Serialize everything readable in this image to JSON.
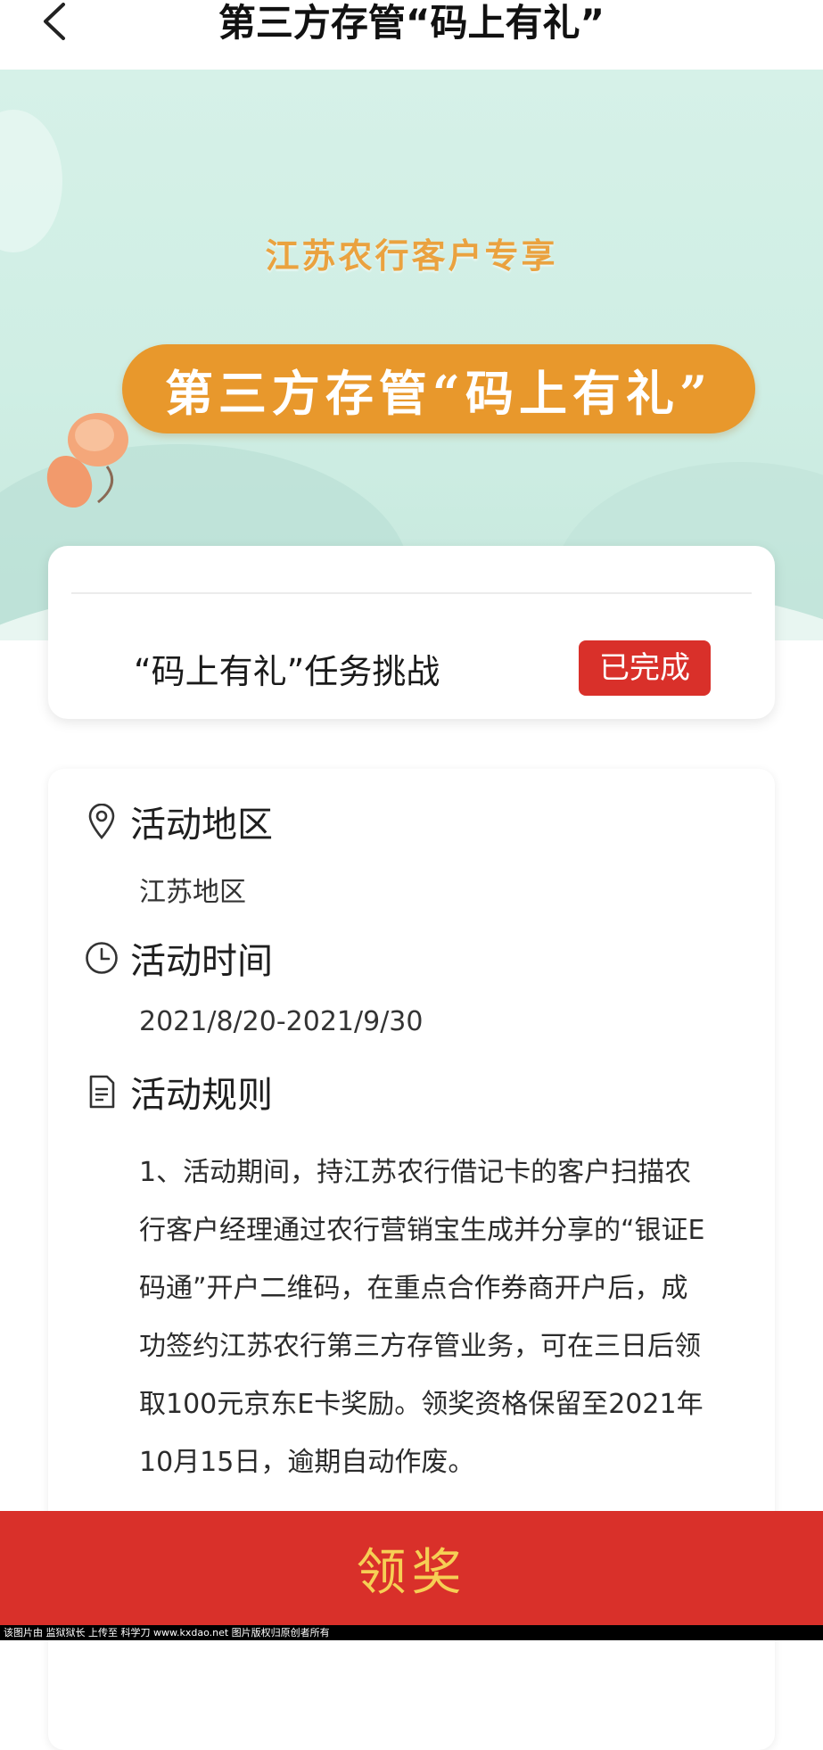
{
  "header": {
    "back_icon": "chevron-left-icon",
    "title": "第三方存管“码上有礼”"
  },
  "hero": {
    "subtitle": "江苏农行客户专享",
    "banner_title": "第三方存管“码上有礼”",
    "colors": {
      "background": "#d6f1e8",
      "pill": "#e8982c",
      "subtitle": "#eaa23f"
    }
  },
  "task": {
    "label": "“码上有礼”任务挑战",
    "status": "已完成",
    "status_color": "#d9302a"
  },
  "info": {
    "region": {
      "icon": "location-pin-icon",
      "title": "活动地区",
      "value": "江苏地区"
    },
    "time": {
      "icon": "clock-icon",
      "title": "活动时间",
      "value": "2021/8/20-2021/9/30"
    },
    "rules": {
      "icon": "document-icon",
      "title": "活动规则",
      "text": "1、活动期间，持江苏农行借记卡的客户扫描农行客户经理通过农行营销宝生成并分享的“银证E码通”开户二维码，在重点合作券商开户后，成功签约江苏农行第三方存管业务，可在三日后领取100元京东E卡奖励。领奖资格保留至2021年10月15日，逾期自动作废。"
    }
  },
  "footer": {
    "claim_label": "领奖",
    "claim_bg": "#d9302a",
    "claim_text_color": "#f6cf55"
  },
  "watermark": {
    "text": "该图片由 监狱狱长 上传至 科学刀 www.kxdao.net 图片版权归原创者所有"
  }
}
